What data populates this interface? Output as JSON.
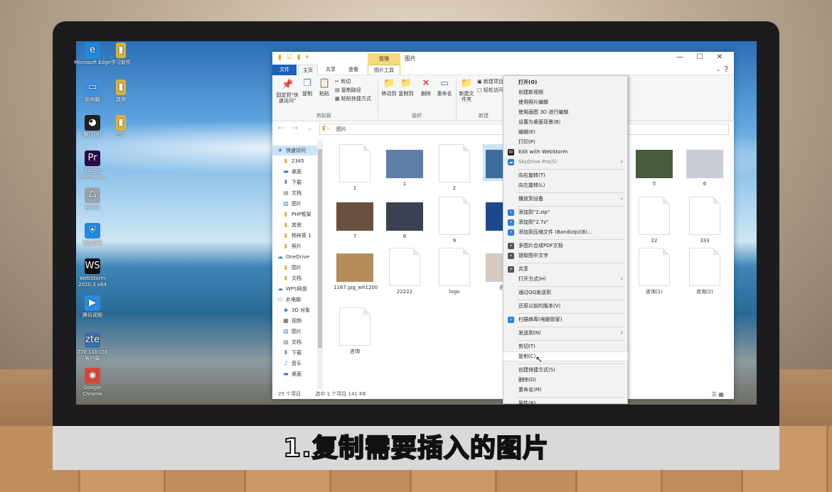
{
  "caption": "1.复制需要插入的图片",
  "desktop_icons": [
    {
      "label": "Microsoft Edge",
      "icon": "edge-icon"
    },
    {
      "label": "学习软件",
      "icon": "folder-zip-icon"
    },
    {
      "label": "此电脑",
      "icon": "computer-icon"
    },
    {
      "label": "其他",
      "icon": "folder-zip-icon"
    },
    {
      "label": "腾讯QQ",
      "icon": "qq-icon"
    },
    {
      "label": "图片",
      "icon": "folder-zip-icon"
    },
    {
      "label": "Adobe Premiere...",
      "icon": "premiere-icon"
    },
    {
      "label": "回收站",
      "icon": "recycle-bin-icon"
    },
    {
      "label": "电脑管家",
      "icon": "shield-icon"
    },
    {
      "label": "WebStorm 2020.3 x64",
      "icon": "webstorm-icon"
    },
    {
      "label": "腾讯视频",
      "icon": "video-icon"
    },
    {
      "label": "ZTE 11b LTE 客户端",
      "icon": "zte-icon"
    },
    {
      "label": "Google Chrome",
      "icon": "chrome-icon"
    }
  ],
  "window": {
    "title": "图片",
    "context_tab": "管理",
    "tabs": [
      "文件",
      "主页",
      "共享",
      "查看",
      "图片工具"
    ],
    "controls": [
      "—",
      "☐",
      "✕"
    ],
    "ribbon": {
      "pin": "固定到\"快速访问\"",
      "copy": "复制",
      "paste": "粘贴",
      "cut": "剪切",
      "copy_path": "复制路径",
      "paste_shortcut": "粘贴快捷方式",
      "clipboard_group": "剪贴板",
      "move_to": "移动到",
      "copy_to": "复制到",
      "delete": "删除",
      "rename": "重命名",
      "organize_group": "组织",
      "new_folder": "新建文件夹",
      "new_item": "新建项目",
      "easy_access": "轻松访问",
      "new_group": "新建"
    },
    "address": {
      "path": "图片"
    },
    "nav": [
      {
        "label": "快速访问",
        "icon": "star-icon",
        "selected": true
      },
      {
        "label": "2345",
        "icon": "folder-icon"
      },
      {
        "label": "桌面",
        "icon": "desktop-icon"
      },
      {
        "label": "下载",
        "icon": "download-icon"
      },
      {
        "label": "文档",
        "icon": "document-icon"
      },
      {
        "label": "图片",
        "icon": "picture-icon"
      },
      {
        "label": "PHP框架",
        "icon": "folder-icon"
      },
      {
        "label": "其他",
        "icon": "folder-icon"
      },
      {
        "label": "杨梓英 1",
        "icon": "folder-icon"
      },
      {
        "label": "照片",
        "icon": "folder-icon"
      },
      {
        "label": "OneDrive",
        "icon": "cloud-icon"
      },
      {
        "label": "图片",
        "icon": "folder-icon"
      },
      {
        "label": "文档",
        "icon": "folder-icon"
      },
      {
        "label": "WPS网盘",
        "icon": "cloud-icon"
      },
      {
        "label": "此电脑",
        "icon": "computer-icon"
      },
      {
        "label": "3D 对象",
        "icon": "cube-icon"
      },
      {
        "label": "视频",
        "icon": "video-icon"
      },
      {
        "label": "图片",
        "icon": "picture-icon"
      },
      {
        "label": "文档",
        "icon": "document-icon"
      },
      {
        "label": "下载",
        "icon": "download-icon"
      },
      {
        "label": "音乐",
        "icon": "music-icon"
      },
      {
        "label": "桌面",
        "icon": "desktop-icon"
      }
    ],
    "files": [
      {
        "name": "1",
        "kind": "doc"
      },
      {
        "name": "1",
        "kind": "pic",
        "color": "#5d7ea6"
      },
      {
        "name": "2",
        "kind": "doc"
      },
      {
        "name": "",
        "kind": "pic",
        "color": "#3c6e9c",
        "selected": true
      },
      {
        "name": "5",
        "kind": "pic",
        "color": "#4a5a3c"
      },
      {
        "name": "6",
        "kind": "pic",
        "color": "#c9ced6"
      },
      {
        "name": "7",
        "kind": "pic",
        "color": "#6b5040"
      },
      {
        "name": "8",
        "kind": "pic",
        "color": "#3a4150"
      },
      {
        "name": "9",
        "kind": "doc"
      },
      {
        "name": "",
        "kind": "pic",
        "color": "#1c4a8a"
      },
      {
        "name": "22",
        "kind": "doc"
      },
      {
        "name": "333",
        "kind": "doc"
      },
      {
        "name": "1167.jpg_wh1200",
        "kind": "pic",
        "color": "#b58d5a"
      },
      {
        "name": "22222",
        "kind": "doc"
      },
      {
        "name": "logo",
        "kind": "doc"
      },
      {
        "name": "进眼",
        "kind": "pic",
        "color": "#d5cbc0"
      },
      {
        "name": "咨询(1)",
        "kind": "doc"
      },
      {
        "name": "咨询(2)",
        "kind": "doc"
      },
      {
        "name": "咨询",
        "kind": "doc"
      }
    ],
    "status": {
      "count": "25 个项目",
      "selected": "选中 1 个项目  141 KB"
    }
  },
  "context_menu": [
    {
      "label": "打开(O)",
      "bold": true
    },
    {
      "label": "创建新视频"
    },
    {
      "label": "使用照片编辑"
    },
    {
      "label": "使用画图 3D 进行编辑"
    },
    {
      "label": "设置为桌面背景(B)"
    },
    {
      "label": "编辑(E)"
    },
    {
      "label": "打印(P)"
    },
    {
      "label": "Edit with WebStorm",
      "icon": "webstorm-icon",
      "icon_color": "#1a1a1a"
    },
    {
      "label": "SkyDrive Pro(S)",
      "icon": "cloud-icon",
      "icon_color": "#2b7cd3",
      "submenu": true,
      "disabled": true
    },
    {
      "sep": true
    },
    {
      "label": "向右旋转(T)"
    },
    {
      "label": "向左旋转(L)"
    },
    {
      "sep": true
    },
    {
      "label": "播放到设备",
      "submenu": true
    },
    {
      "sep": true
    },
    {
      "label": "添加到\"2.zip\"",
      "icon": "bandizip-icon",
      "icon_color": "#2f7de1"
    },
    {
      "label": "添加到\"2.7z\"",
      "icon": "bandizip-icon",
      "icon_color": "#2f7de1"
    },
    {
      "label": "添加到压缩文件 (Bandizip)(B)...",
      "icon": "bandizip-icon",
      "icon_color": "#2f7de1"
    },
    {
      "sep": true
    },
    {
      "label": "多图片合成PDF文档",
      "icon": "pdf-icon",
      "icon_color": "#555"
    },
    {
      "label": "提取图中文字",
      "icon": "ocr-icon",
      "icon_color": "#555"
    },
    {
      "sep": true
    },
    {
      "label": "共享",
      "icon": "share-icon",
      "icon_color": "#555"
    },
    {
      "label": "打开方式(H)",
      "submenu": true
    },
    {
      "sep": true
    },
    {
      "label": "通过QQ发送到"
    },
    {
      "sep": true
    },
    {
      "label": "还原以前的版本(V)"
    },
    {
      "sep": true
    },
    {
      "label": "扫描病毒(电脑管家)",
      "icon": "shield-icon",
      "icon_color": "#1e88e5"
    },
    {
      "sep": true
    },
    {
      "label": "发送到(N)",
      "submenu": true
    },
    {
      "sep": true
    },
    {
      "label": "剪切(T)"
    },
    {
      "label": "复制(C)",
      "highlight": true
    },
    {
      "sep": true
    },
    {
      "label": "创建快捷方式(S)"
    },
    {
      "label": "删除(D)"
    },
    {
      "label": "重命名(M)"
    },
    {
      "sep": true
    },
    {
      "label": "属性(R)"
    }
  ],
  "colors": {
    "accent": "#1b62b8",
    "ribbon_bg": "#f5f6f7",
    "context_tab": "#f5d97a",
    "selection": "#cce4f7"
  }
}
